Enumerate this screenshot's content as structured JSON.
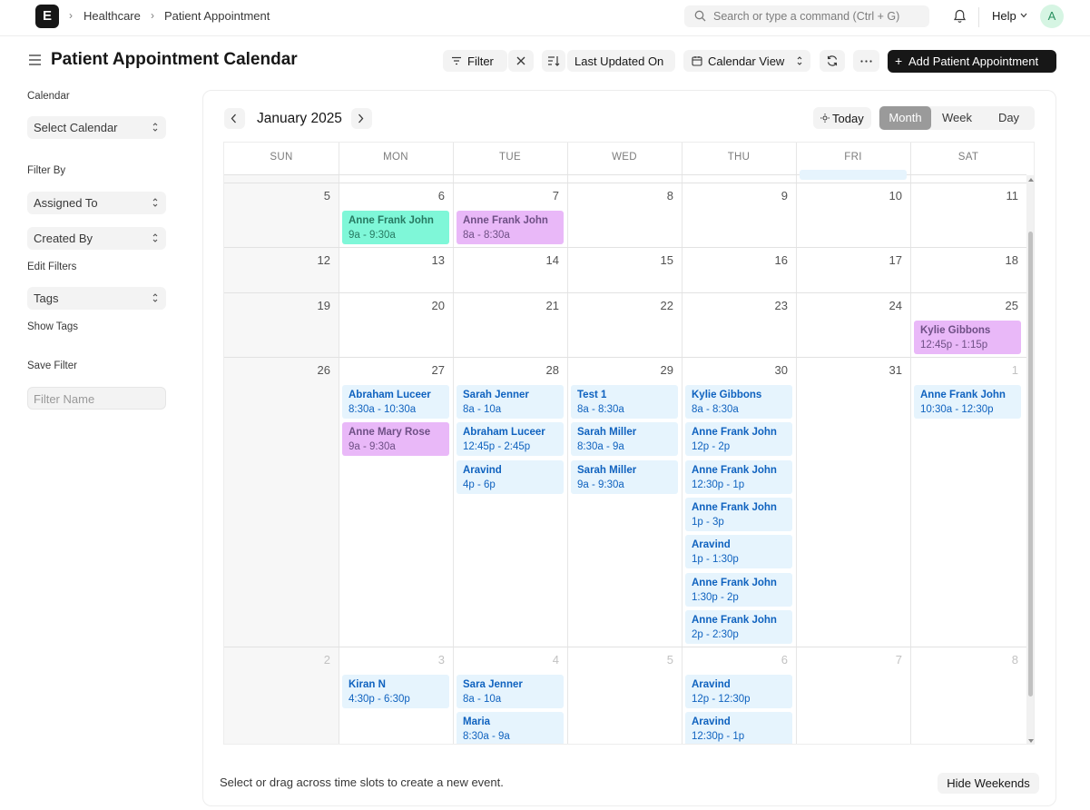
{
  "navbar": {
    "logo": "E",
    "breadcrumbs": [
      "Healthcare",
      "Patient Appointment"
    ],
    "search_placeholder": "Search or type a command (Ctrl + G)",
    "help": "Help",
    "avatar": "A"
  },
  "header": {
    "title": "Patient Appointment Calendar",
    "filter": "Filter",
    "sort": "Last Updated On",
    "view": "Calendar View",
    "add": "Add Patient Appointment"
  },
  "sidebar": {
    "calendar_label": "Calendar",
    "select_calendar": "Select Calendar",
    "filter_by": "Filter By",
    "assigned_to": "Assigned To",
    "created_by": "Created By",
    "edit_filters": "Edit Filters",
    "tags": "Tags",
    "show_tags": "Show Tags",
    "save_filter": "Save Filter",
    "filter_name_placeholder": "Filter Name"
  },
  "calendar": {
    "month": "January 2025",
    "today": "Today",
    "views": [
      "Month",
      "Week",
      "Day"
    ],
    "active_view": "Month",
    "weekdays": [
      "SUN",
      "MON",
      "TUE",
      "WED",
      "THU",
      "FRI",
      "SAT"
    ],
    "weeks": [
      {
        "days": [
          "5",
          "6",
          "7",
          "8",
          "9",
          "10",
          "11"
        ],
        "muted": [
          false,
          false,
          false,
          false,
          false,
          false,
          false
        ]
      },
      {
        "days": [
          "12",
          "13",
          "14",
          "15",
          "16",
          "17",
          "18"
        ],
        "muted": [
          false,
          false,
          false,
          false,
          false,
          false,
          false
        ]
      },
      {
        "days": [
          "19",
          "20",
          "21",
          "22",
          "23",
          "24",
          "25"
        ],
        "muted": [
          false,
          false,
          false,
          false,
          false,
          false,
          false
        ]
      },
      {
        "days": [
          "26",
          "27",
          "28",
          "29",
          "30",
          "31",
          "1"
        ],
        "muted": [
          false,
          false,
          false,
          false,
          false,
          false,
          true
        ]
      },
      {
        "days": [
          "2",
          "3",
          "4",
          "5",
          "6",
          "7",
          "8"
        ],
        "muted": [
          true,
          true,
          true,
          true,
          true,
          true,
          true
        ]
      }
    ],
    "events": [
      {
        "week": 0,
        "day": 1,
        "slot": 0,
        "name": "Anne Frank John",
        "time": "9a - 9:30a",
        "color": "green"
      },
      {
        "week": 0,
        "day": 2,
        "slot": 0,
        "name": "Anne Frank John",
        "time": "8a - 8:30a",
        "color": "purple"
      },
      {
        "week": 2,
        "day": 6,
        "slot": 0,
        "name": "Kylie Gibbons",
        "time": "12:45p - 1:15p",
        "color": "purple"
      },
      {
        "week": 3,
        "day": 1,
        "slot": 0,
        "name": "Abraham Luceer",
        "time": "8:30a - 10:30a",
        "color": "blue"
      },
      {
        "week": 3,
        "day": 1,
        "slot": 1,
        "name": "Anne Mary Rose",
        "time": "9a - 9:30a",
        "color": "purple"
      },
      {
        "week": 3,
        "day": 2,
        "slot": 0,
        "name": "Sarah Jenner",
        "time": "8a - 10a",
        "color": "blue"
      },
      {
        "week": 3,
        "day": 2,
        "slot": 1,
        "name": "Abraham Luceer",
        "time": "12:45p - 2:45p",
        "color": "blue"
      },
      {
        "week": 3,
        "day": 2,
        "slot": 2,
        "name": "Aravind",
        "time": "4p - 6p",
        "color": "blue"
      },
      {
        "week": 3,
        "day": 3,
        "slot": 0,
        "name": "Test 1",
        "time": "8a - 8:30a",
        "color": "blue"
      },
      {
        "week": 3,
        "day": 3,
        "slot": 1,
        "name": "Sarah Miller",
        "time": "8:30a - 9a",
        "color": "blue"
      },
      {
        "week": 3,
        "day": 3,
        "slot": 2,
        "name": "Sarah Miller",
        "time": "9a - 9:30a",
        "color": "blue"
      },
      {
        "week": 3,
        "day": 4,
        "slot": 0,
        "name": "Kylie Gibbons",
        "time": "8a - 8:30a",
        "color": "blue"
      },
      {
        "week": 3,
        "day": 4,
        "slot": 1,
        "name": "Anne Frank John",
        "time": "12p - 2p",
        "color": "blue"
      },
      {
        "week": 3,
        "day": 4,
        "slot": 2,
        "name": "Anne Frank John",
        "time": "12:30p - 1p",
        "color": "blue"
      },
      {
        "week": 3,
        "day": 4,
        "slot": 3,
        "name": "Anne Frank John",
        "time": "1p - 3p",
        "color": "blue"
      },
      {
        "week": 3,
        "day": 4,
        "slot": 4,
        "name": "Aravind",
        "time": "1p - 1:30p",
        "color": "blue"
      },
      {
        "week": 3,
        "day": 4,
        "slot": 5,
        "name": "Anne Frank John",
        "time": "1:30p - 2p",
        "color": "blue"
      },
      {
        "week": 3,
        "day": 4,
        "slot": 6,
        "name": "Anne Frank John",
        "time": "2p - 2:30p",
        "color": "blue"
      },
      {
        "week": 3,
        "day": 6,
        "slot": 0,
        "name": "Anne Frank John",
        "time": "10:30a - 12:30p",
        "color": "blue"
      },
      {
        "week": 4,
        "day": 1,
        "slot": 0,
        "name": "Kiran N",
        "time": "4:30p - 6:30p",
        "color": "blue"
      },
      {
        "week": 4,
        "day": 2,
        "slot": 0,
        "name": "Sara Jenner",
        "time": "8a - 10a",
        "color": "blue"
      },
      {
        "week": 4,
        "day": 2,
        "slot": 1,
        "name": "Maria",
        "time": "8:30a - 9a",
        "color": "blue"
      },
      {
        "week": 4,
        "day": 4,
        "slot": 0,
        "name": "Aravind",
        "time": "12p - 12:30p",
        "color": "blue"
      },
      {
        "week": 4,
        "day": 4,
        "slot": 1,
        "name": "Aravind",
        "time": "12:30p - 1p",
        "color": "blue"
      }
    ]
  },
  "footer": {
    "hint": "Select or drag across time slots to create a new event.",
    "hide_weekends": "Hide Weekends"
  }
}
